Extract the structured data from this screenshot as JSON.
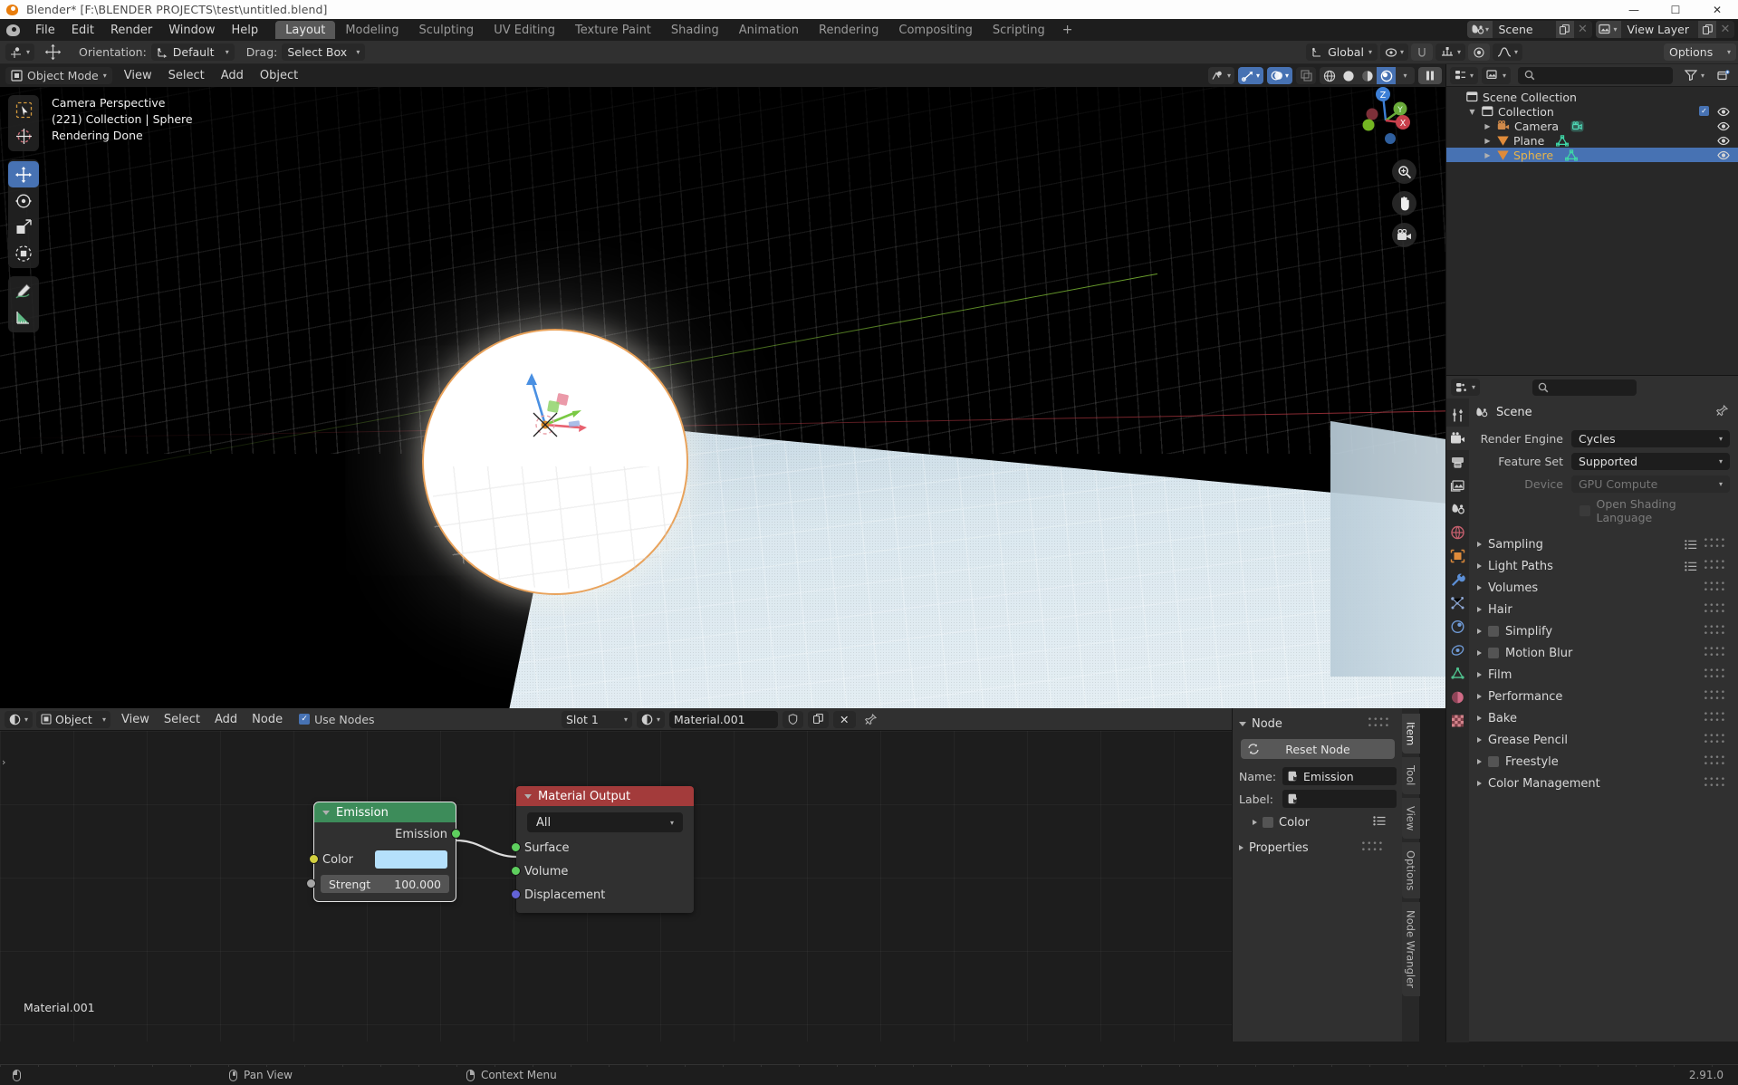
{
  "window": {
    "title": "Blender* [F:\\BLENDER PROJECTS\\test\\untitled.blend]",
    "minimize": "—",
    "maximize": "☐",
    "close": "✕"
  },
  "topbar": {
    "menus": [
      "File",
      "Edit",
      "Render",
      "Window",
      "Help"
    ],
    "workspaces": [
      "Layout",
      "Modeling",
      "Sculpting",
      "UV Editing",
      "Texture Paint",
      "Shading",
      "Animation",
      "Rendering",
      "Compositing",
      "Scripting"
    ],
    "active_workspace": "Layout",
    "add_workspace": "+",
    "scene_name": "Scene",
    "view_layer_name": "View Layer"
  },
  "tool_settings": {
    "orientation_label": "Orientation:",
    "orientation_value": "Default",
    "drag_label": "Drag:",
    "drag_value": "Select Box",
    "transform_orientation": "Global",
    "options_label": "Options"
  },
  "viewport": {
    "mode": "Object Mode",
    "menus": [
      "View",
      "Select",
      "Add",
      "Object"
    ],
    "overlay": {
      "line1": "Camera Perspective",
      "line2": "(221) Collection | Sphere",
      "line3": "Rendering Done"
    },
    "gizmo_axes": [
      "Z",
      "Y",
      "X"
    ],
    "toolbar_tools": [
      "select-box-tool",
      "cursor-tool",
      "move-tool",
      "rotate-tool",
      "scale-tool",
      "transform-tool",
      "annotate-tool",
      "measure-tool"
    ],
    "active_tool": "move-tool",
    "shading_modes": [
      "wireframe",
      "solid",
      "material-preview",
      "rendered"
    ],
    "active_shading": "rendered"
  },
  "outliner": {
    "rows": [
      {
        "label": "Scene Collection",
        "indent": 0,
        "icon": "collection-icon",
        "selected": false,
        "has_disclosure": false,
        "checkbox": false,
        "eye": false
      },
      {
        "label": "Collection",
        "indent": 1,
        "icon": "collection-icon",
        "selected": false,
        "has_disclosure": true,
        "checkbox": true,
        "eye": true
      },
      {
        "label": "Camera",
        "indent": 2,
        "icon": "camera-object-icon",
        "selected": false,
        "has_disclosure": true,
        "checkbox": false,
        "eye": true,
        "data_icon": "camera-data-icon"
      },
      {
        "label": "Plane",
        "indent": 2,
        "icon": "mesh-object-icon",
        "selected": false,
        "has_disclosure": true,
        "checkbox": false,
        "eye": true,
        "data_icon": "mesh-data-icon"
      },
      {
        "label": "Sphere",
        "indent": 2,
        "icon": "mesh-object-icon",
        "selected": true,
        "has_disclosure": true,
        "checkbox": false,
        "eye": true,
        "data_icon": "mesh-data-icon"
      }
    ]
  },
  "properties": {
    "breadcrumb": "Scene",
    "render_engine_label": "Render Engine",
    "render_engine_value": "Cycles",
    "feature_set_label": "Feature Set",
    "feature_set_value": "Supported",
    "device_label": "Device",
    "device_value": "GPU Compute",
    "osl_label": "Open Shading Language",
    "panels": [
      {
        "label": "Sampling",
        "checkbox": false,
        "list_icon": true
      },
      {
        "label": "Light Paths",
        "checkbox": false,
        "list_icon": true
      },
      {
        "label": "Volumes",
        "checkbox": false,
        "list_icon": false
      },
      {
        "label": "Hair",
        "checkbox": false,
        "list_icon": false
      },
      {
        "label": "Simplify",
        "checkbox": true,
        "list_icon": false
      },
      {
        "label": "Motion Blur",
        "checkbox": true,
        "list_icon": false
      },
      {
        "label": "Film",
        "checkbox": false,
        "list_icon": false
      },
      {
        "label": "Performance",
        "checkbox": false,
        "list_icon": false
      },
      {
        "label": "Bake",
        "checkbox": false,
        "list_icon": false
      },
      {
        "label": "Grease Pencil",
        "checkbox": false,
        "list_icon": false
      },
      {
        "label": "Freestyle",
        "checkbox": true,
        "list_icon": false
      },
      {
        "label": "Color Management",
        "checkbox": false,
        "list_icon": false
      }
    ]
  },
  "shader_editor": {
    "mode": "Object",
    "menus": [
      "View",
      "Select",
      "Add",
      "Node"
    ],
    "use_nodes_label": "Use Nodes",
    "use_nodes_checked": true,
    "slot": "Slot 1",
    "material_name": "Material.001",
    "canvas_label": "Material.001",
    "nodes": [
      {
        "name": "Emission",
        "header_color": "#3d8c5a",
        "selected": true,
        "outputs": [
          {
            "label": "Emission",
            "socket_color": "#5ecf5e"
          }
        ],
        "color_label": "Color",
        "color_value": "#b5e0fb",
        "color_socket": "#d2cf3e",
        "strength_label": "Strengt",
        "strength_value": "100.000",
        "strength_socket": "#a6a6a6"
      },
      {
        "name": "Material Output",
        "header_color": "#a33b3b",
        "selected": false,
        "target_value": "All",
        "inputs": [
          {
            "label": "Surface",
            "socket_color": "#5ecf5e"
          },
          {
            "label": "Volume",
            "socket_color": "#5ecf5e"
          },
          {
            "label": "Displacement",
            "socket_color": "#6363d6"
          }
        ]
      }
    ]
  },
  "node_sidebar": {
    "tabs": [
      "Item",
      "Tool",
      "View",
      "Options",
      "Node Wrangler"
    ],
    "active_tab": "Item",
    "section_node": "Node",
    "reset_node": "Reset Node",
    "name_label": "Name:",
    "name_value": "Emission",
    "label_label": "Label:",
    "label_value": "",
    "color_label": "Color",
    "section_properties": "Properties"
  },
  "statusbar": {
    "pan_view": "Pan View",
    "context_menu": "Context Menu",
    "version": "2.91.0"
  },
  "colors": {
    "accent_blue": "#4772b3",
    "selection_orange": "#e9a35c",
    "emission_green": "#3d8c5a",
    "output_red": "#a33b3b"
  }
}
